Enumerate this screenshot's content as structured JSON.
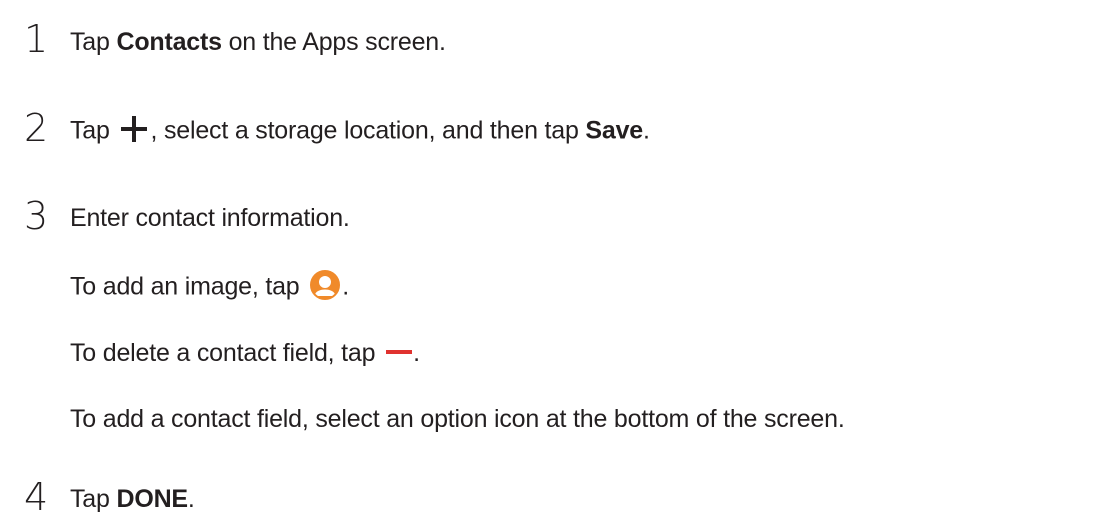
{
  "steps": [
    {
      "number": "1",
      "lines": [
        {
          "prefix": "Tap ",
          "bold": "Contacts",
          "suffix": " on the Apps screen."
        }
      ]
    },
    {
      "number": "2",
      "lines": [
        {
          "prefix": "Tap ",
          "icon": "plus-icon",
          "middle": ", select a storage location, and then tap ",
          "bold": "Save",
          "suffix": "."
        }
      ]
    },
    {
      "number": "3",
      "lines": [
        {
          "text": "Enter contact information."
        },
        {
          "prefix": "To add an image, tap ",
          "icon": "add-image-icon",
          "suffix": "."
        },
        {
          "prefix": "To delete a contact field, tap ",
          "icon": "minus-icon",
          "suffix": "."
        },
        {
          "text": "To add a contact field, select an option icon at the bottom of the screen."
        }
      ]
    },
    {
      "number": "4",
      "lines": [
        {
          "prefix": "Tap ",
          "bold": "DONE",
          "suffix": "."
        }
      ]
    }
  ],
  "colors": {
    "text": "#231f20",
    "image_icon": "#f08a2a",
    "minus_icon": "#e0322f"
  }
}
